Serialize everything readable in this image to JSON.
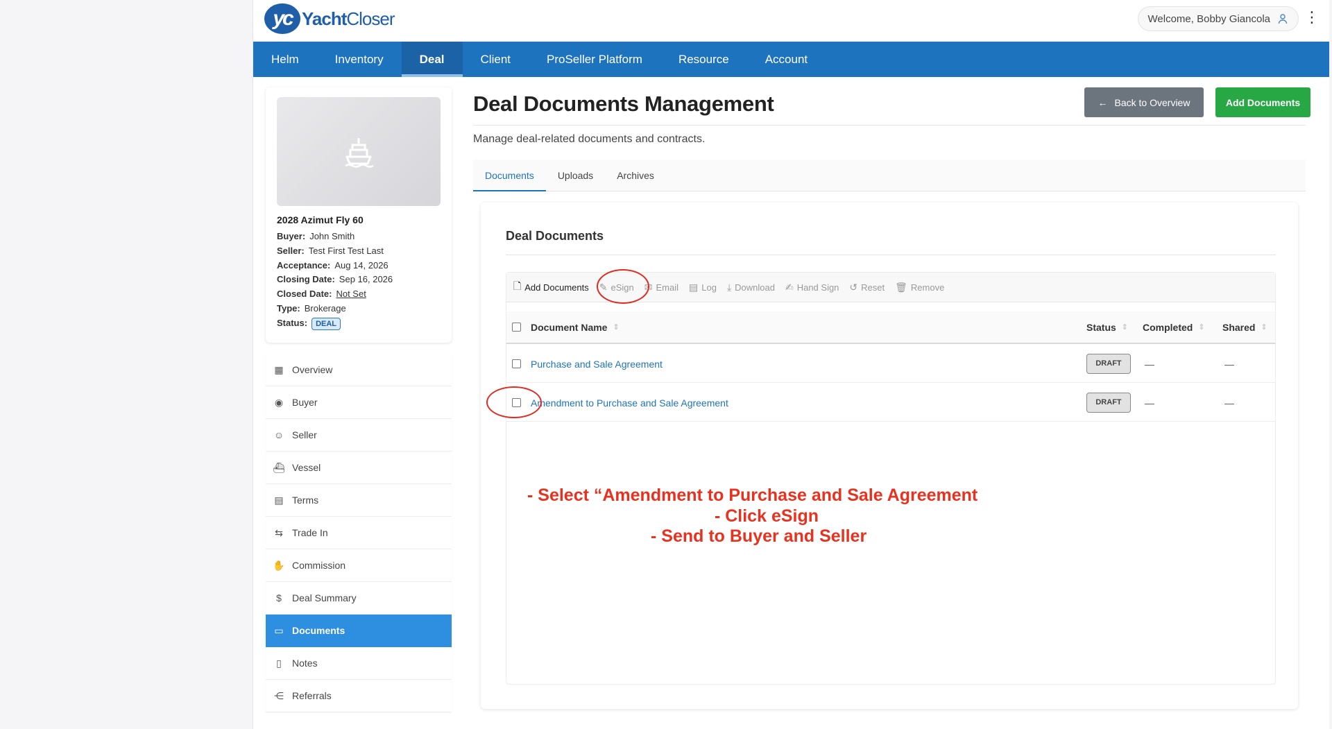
{
  "header": {
    "logo_mark": "yc",
    "logo_text_bold": "Yacht",
    "logo_text_light": "Closer",
    "welcome": "Welcome, Bobby Giancola",
    "user_icon": "user-icon",
    "menu_icon": "kebab-icon"
  },
  "nav": {
    "items": [
      {
        "label": "Helm",
        "active": false
      },
      {
        "label": "Inventory",
        "active": false
      },
      {
        "label": "Deal",
        "active": true
      },
      {
        "label": "Client",
        "active": false
      },
      {
        "label": "ProSeller Platform",
        "active": false
      },
      {
        "label": "Resource",
        "active": false
      },
      {
        "label": "Account",
        "active": false
      }
    ],
    "color": "#1e73be"
  },
  "deal_card": {
    "image_icon": "ship-icon",
    "vessel": "2028 Azimut Fly 60",
    "buyer_label": "Buyer:",
    "buyer": "John Smith",
    "seller_label": "Seller:",
    "seller": "Test First Test Last",
    "acceptance_label": "Acceptance:",
    "acceptance": "Aug 14, 2026",
    "closing_label": "Closing Date:",
    "closing": "Sep 16, 2026",
    "closed_label": "Closed Date:",
    "closed": "Not Set",
    "type_label": "Type:",
    "type": "Brokerage",
    "status_label": "Status:",
    "status": "DEAL"
  },
  "sidebar": {
    "items": [
      {
        "label": "Overview",
        "icon": "grid-icon"
      },
      {
        "label": "Buyer",
        "icon": "user-circle-icon"
      },
      {
        "label": "Seller",
        "icon": "user-icon"
      },
      {
        "label": "Vessel",
        "icon": "ship-icon"
      },
      {
        "label": "Terms",
        "icon": "document-icon"
      },
      {
        "label": "Trade In",
        "icon": "swap-icon"
      },
      {
        "label": "Commission",
        "icon": "hand-coins-icon"
      },
      {
        "label": "Deal Summary",
        "icon": "dollar-circle-icon"
      },
      {
        "label": "Documents",
        "icon": "folder-open-icon",
        "active": true
      },
      {
        "label": "Notes",
        "icon": "file-icon"
      },
      {
        "label": "Referrals",
        "icon": "share-icon"
      }
    ]
  },
  "main": {
    "title": "Deal Documents Management",
    "subtitle": "Manage deal-related documents and contracts.",
    "back_button": "Back to Overview",
    "add_button": "Add Documents",
    "tabs": [
      {
        "label": "Documents",
        "active": true
      },
      {
        "label": "Uploads",
        "active": false
      },
      {
        "label": "Archives",
        "active": false
      }
    ]
  },
  "documents": {
    "card_title": "Deal Documents",
    "toolbar": [
      {
        "label": "Add Documents",
        "icon": "file-plus-icon",
        "enabled": true
      },
      {
        "label": "eSign",
        "icon": "signature-icon",
        "enabled": false
      },
      {
        "label": "Email",
        "icon": "mail-icon",
        "enabled": false
      },
      {
        "label": "Log",
        "icon": "log-icon",
        "enabled": false
      },
      {
        "label": "Download",
        "icon": "download-icon",
        "enabled": false
      },
      {
        "label": "Hand Sign",
        "icon": "pen-icon",
        "enabled": false
      },
      {
        "label": "Reset",
        "icon": "reset-icon",
        "enabled": false
      },
      {
        "label": "Remove",
        "icon": "trash-icon",
        "enabled": false
      }
    ],
    "columns": [
      "Document Name",
      "Status",
      "Completed",
      "Shared"
    ],
    "rows": [
      {
        "name": "Purchase and Sale Agreement",
        "status": "DRAFT",
        "completed": "—",
        "shared": "—"
      },
      {
        "name": "Amendment to Purchase and Sale Agreement",
        "status": "DRAFT",
        "completed": "—",
        "shared": "—"
      }
    ]
  },
  "annotation": {
    "lines": [
      "- Select “Amendment to Purchase and Sale Agreement",
      "- Click eSign",
      "- Send to Buyer and Seller"
    ],
    "color": "#e8311f"
  }
}
